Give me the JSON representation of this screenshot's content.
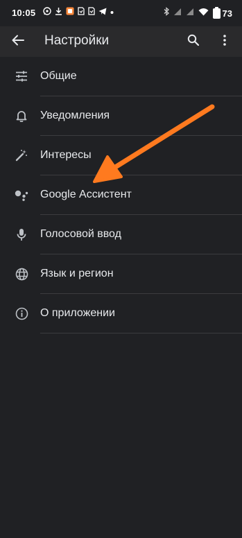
{
  "status_bar": {
    "time": "10:05",
    "battery_level": "73",
    "icons_left": [
      "whatsapp-icon",
      "download-icon",
      "notification-app-icon",
      "sim-icon",
      "sim-icon",
      "telegram-icon",
      "more-dot-icon"
    ],
    "icons_right": [
      "bluetooth-icon",
      "signal-icon",
      "signal-icon",
      "wifi-icon",
      "battery-icon"
    ]
  },
  "app_bar": {
    "title": "Настройки",
    "back_icon": "arrow-back-icon",
    "search_icon": "search-icon",
    "more_icon": "more-vert-icon"
  },
  "settings": {
    "items": [
      {
        "label": "Общие",
        "icon": "tune-icon"
      },
      {
        "label": "Уведомления",
        "icon": "bell-icon"
      },
      {
        "label": "Интересы",
        "icon": "magic-wand-icon"
      },
      {
        "label": "Google Ассистент",
        "icon": "assistant-icon"
      },
      {
        "label": "Голосовой ввод",
        "icon": "mic-icon"
      },
      {
        "label": "Язык и регион",
        "icon": "globe-icon"
      },
      {
        "label": "О приложении",
        "icon": "info-icon"
      }
    ]
  },
  "colors": {
    "background": "#202124",
    "app_bar": "#2a2a2c",
    "text": "#e8eaed",
    "icon": "#bdc1c6",
    "divider": "#3c3c3f",
    "annotation_arrow": "#ff7a1f"
  }
}
